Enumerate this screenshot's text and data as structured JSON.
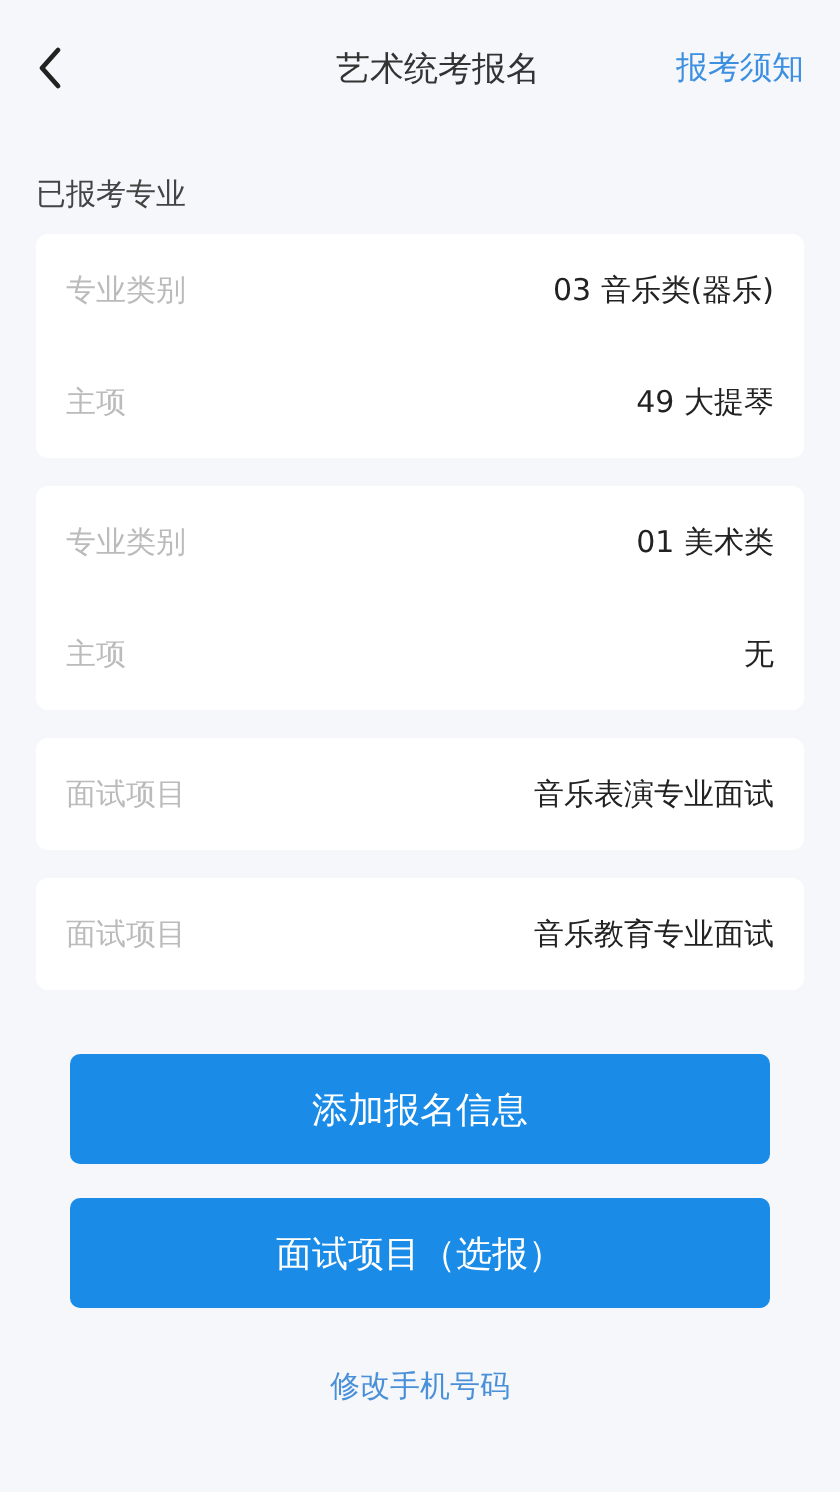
{
  "header": {
    "title": "艺术统考报名",
    "action": "报考须知"
  },
  "section_title": "已报考专业",
  "cards": [
    {
      "rows": [
        {
          "label": "专业类别",
          "value": "03 音乐类(器乐)"
        },
        {
          "label": "主项",
          "value": "49 大提琴"
        }
      ]
    },
    {
      "rows": [
        {
          "label": "专业类别",
          "value": "01 美术类"
        },
        {
          "label": "主项",
          "value": "无"
        }
      ]
    },
    {
      "rows": [
        {
          "label": "面试项目",
          "value": "音乐表演专业面试"
        }
      ]
    },
    {
      "rows": [
        {
          "label": "面试项目",
          "value": "音乐教育专业面试"
        }
      ]
    }
  ],
  "buttons": [
    "添加报名信息",
    "面试项目（选报）"
  ],
  "link": "修改手机号码"
}
